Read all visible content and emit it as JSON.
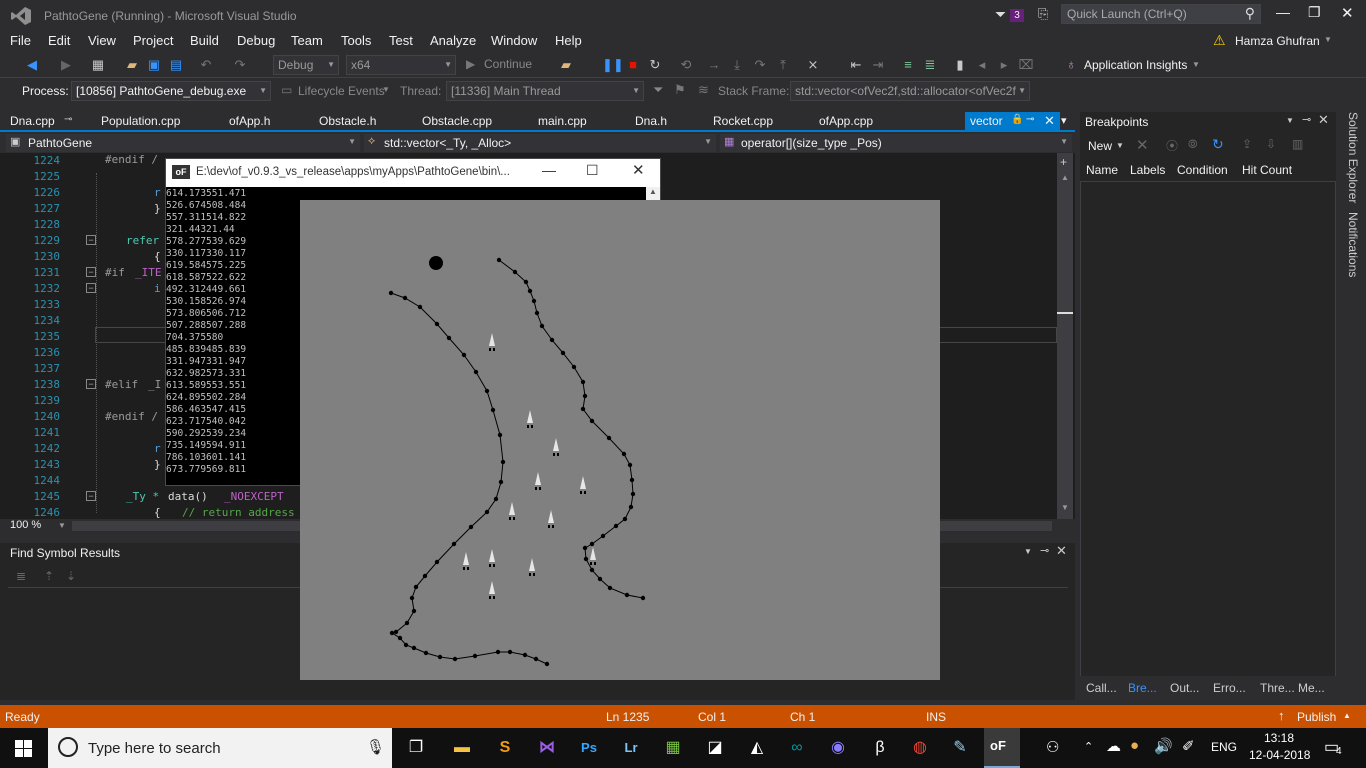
{
  "titlebar": {
    "title": "PathtoGene (Running) - Microsoft Visual Studio",
    "notif_count": "3",
    "quick_launch_placeholder": "Quick Launch (Ctrl+Q)"
  },
  "menu": [
    "File",
    "Edit",
    "View",
    "Project",
    "Build",
    "Debug",
    "Team",
    "Tools",
    "Test",
    "Analyze",
    "Window",
    "Help"
  ],
  "user": {
    "name": "Hamza Ghufran"
  },
  "toolbar": {
    "config": "Debug",
    "platform": "x64",
    "continue_label": "Continue",
    "app_insights": "Application Insights"
  },
  "debugbar": {
    "process_label": "Process:",
    "process_value": "[10856] PathtoGene_debug.exe",
    "lifecycle": "Lifecycle Events",
    "thread_label": "Thread:",
    "thread_value": "[11336] Main Thread",
    "stackframe_label": "Stack Frame:",
    "stackframe_value": "std::vector<ofVec2f,std::allocator<ofVec2f"
  },
  "tabs": [
    "Dna.cpp",
    "Population.cpp",
    "ofApp.h",
    "Obstacle.h",
    "Obstacle.cpp",
    "main.cpp",
    "Dna.h",
    "Rocket.cpp",
    "ofApp.cpp",
    "vector"
  ],
  "navbar": {
    "project": "PathtoGene",
    "scope": "std::vector<_Ty, _Alloc>",
    "member": "operator[](size_type _Pos)"
  },
  "editor": {
    "line_numbers": [
      "1224",
      "1225",
      "1226",
      "1227",
      "1228",
      "1229",
      "1230",
      "1231",
      "1232",
      "1233",
      "1234",
      "1235",
      "1236",
      "1237",
      "1238",
      "1239",
      "1240",
      "1241",
      "1242",
      "1243",
      "1244",
      "1245",
      "1246"
    ],
    "snippets": {
      "l1224": "#endif /",
      "l1226": "r",
      "l1227": "}",
      "l1229": "refer",
      "l1230": "{",
      "l1231a": "#if ",
      "l1231b": "_ITE",
      "l1232": "i",
      "l1238a": "#elif ",
      "l1238b": "_I",
      "l1240": "#endif /",
      "l1242": "r",
      "l1243": "}",
      "l1245a": "_Ty * ",
      "l1245b": "data() ",
      "l1245c": "_NOEXCEPT",
      "l1246a": "{   ",
      "l1246b": "// return address"
    },
    "zoom": "100 %"
  },
  "console": {
    "title": "E:\\dev\\of_v0.9.3_vs_release\\apps\\myApps\\PathtoGene\\bin\\...",
    "lines": [
      "614.173551.471",
      "526.674508.484",
      "557.311514.822",
      "321.44321.44",
      "578.277539.629",
      "330.117330.117",
      "619.584575.225",
      "618.587522.622",
      "492.312449.661",
      "530.158526.974",
      "573.806506.712",
      "507.288507.288",
      "704.375580",
      "485.839485.839",
      "331.947331.947",
      "632.982573.331",
      "613.589553.551",
      "624.895502.284",
      "586.463547.415",
      "623.717540.042",
      "590.292539.234",
      "735.149594.911",
      "786.103601.141",
      "673.779569.811"
    ]
  },
  "find_panel": {
    "title": "Find Symbol Results"
  },
  "breakpoints": {
    "title": "Breakpoints",
    "new_label": "New",
    "columns": [
      "Name",
      "Labels",
      "Condition",
      "Hit Count"
    ],
    "bottom_tabs": [
      "Call...",
      "Bre...",
      "Out...",
      "Erro...",
      "Thre...",
      "Me..."
    ]
  },
  "side_strip": [
    "Solution Explorer",
    "Notifications"
  ],
  "status": {
    "state": "Ready",
    "ln": "Ln 1235",
    "col": "Col 1",
    "ch": "Ch 1",
    "ins": "INS",
    "publish": "Publish"
  },
  "taskbar": {
    "search_placeholder": "Type here to search",
    "lang": "ENG",
    "time": "13:18",
    "date": "12-04-2018",
    "notif": "4",
    "icons": [
      "task-view-icon",
      "file-explorer-icon",
      "sublime-icon",
      "visual-studio-icon",
      "photoshop-icon",
      "lightroom-icon",
      "app-grid-icon",
      "notepad-icon",
      "unity-icon",
      "arduino-icon",
      "github-icon",
      "beta-icon",
      "chrome-icon",
      "paint-icon",
      "openframeworks-icon"
    ]
  },
  "colors": {
    "accent_status": "#ca5100",
    "editor_bg": "#1e1e1e",
    "chrome_bg": "#2d2d30",
    "sim_bg": "#808080",
    "active_tab": "#007acc",
    "keyword": "#569cd6",
    "macro": "#9b9b9b",
    "comment": "#57a64a",
    "purple": "#bd63c5"
  }
}
